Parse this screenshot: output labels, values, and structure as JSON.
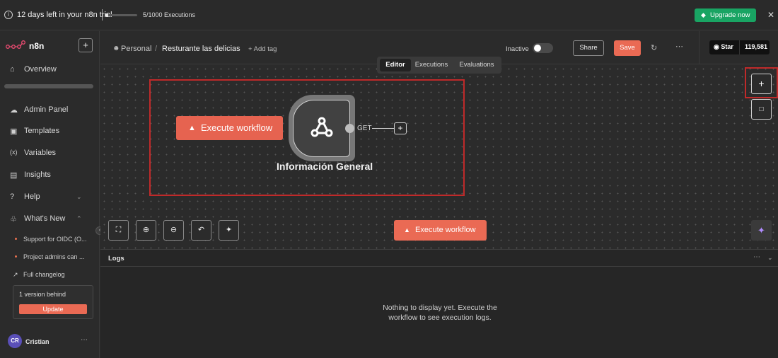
{
  "banner": {
    "trial_text": "12 days left in your n8n trial",
    "executions_text": "5/1000 Executions",
    "executions_used": 5,
    "executions_limit": 1000,
    "upgrade_label": "Upgrade now",
    "upgrade_color": "#19a463"
  },
  "sidebar": {
    "logo_text": "n8n",
    "add_label": "+",
    "items": [
      {
        "label": "Overview",
        "icon": "home-icon"
      },
      {
        "label": "Admin Panel",
        "icon": "cloud-icon"
      },
      {
        "label": "Templates",
        "icon": "box-icon"
      },
      {
        "label": "Variables",
        "icon": "variables-icon"
      },
      {
        "label": "Insights",
        "icon": "chart-icon"
      },
      {
        "label": "Help",
        "icon": "help-icon"
      },
      {
        "label": "What's New",
        "icon": "bell-icon"
      }
    ],
    "whats_new": [
      {
        "label": "Support for OIDC (O..."
      },
      {
        "label": "Project admins can ..."
      }
    ],
    "changelog_label": "Full changelog",
    "version_text": "1 version behind",
    "update_label": "Update",
    "user_initials": "CR",
    "user_name": "Cristian"
  },
  "header": {
    "project": "Personal",
    "workflow_name": "Resturante las delicias",
    "add_tag": "+ Add tag",
    "status": "Inactive",
    "share_label": "Share",
    "save_label": "Save",
    "github_star_label": "Star",
    "github_star_count": "119,581",
    "accent_color": "#ea6a54"
  },
  "tabs": [
    {
      "label": "Editor",
      "active": true
    },
    {
      "label": "Executions",
      "active": false
    },
    {
      "label": "Evaluations",
      "active": false
    }
  ],
  "canvas": {
    "trigger_button_label": "Execute workflow",
    "node_name": "Información General",
    "node_icon": "webhook-icon",
    "node_output_label": "GET",
    "execute_button_label": "Execute workflow"
  },
  "logs": {
    "title": "Logs",
    "empty_text": "Nothing to display yet. Execute the workflow to see execution logs."
  }
}
